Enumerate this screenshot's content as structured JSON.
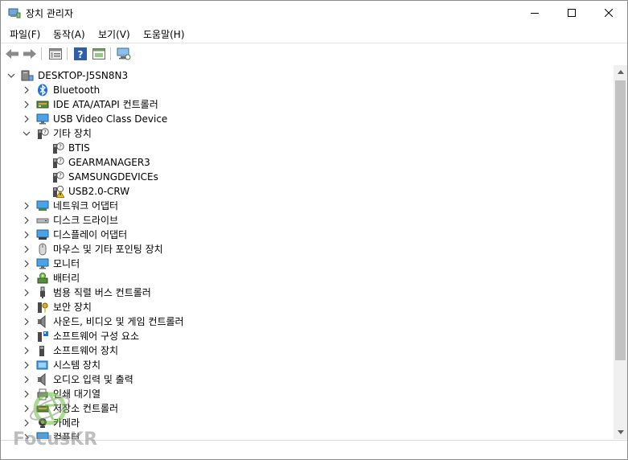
{
  "window": {
    "title": "장치 관리자"
  },
  "menu": {
    "items": [
      "파일(F)",
      "동작(A)",
      "보기(V)",
      "도움말(H)"
    ]
  },
  "toolbar": {
    "buttons": [
      "back-arrow-icon",
      "forward-arrow-icon",
      "properties-icon",
      "help-icon",
      "update-driver-icon",
      "scan-hardware-icon"
    ]
  },
  "tree": {
    "root": "DESKTOP-J5SN8N3",
    "items": [
      {
        "label": "Bluetooth",
        "icon": "bluetooth-icon",
        "expander": "collapsed",
        "level": 1
      },
      {
        "label": "IDE ATA/ATAPI 컨트롤러",
        "icon": "ide-controller-icon",
        "expander": "collapsed",
        "level": 1
      },
      {
        "label": "USB Video Class Device",
        "icon": "monitor-icon",
        "expander": "collapsed",
        "level": 1
      },
      {
        "label": "기타 장치",
        "icon": "unknown-device-icon",
        "expander": "expanded",
        "level": 1
      },
      {
        "label": "BTIS",
        "icon": "unknown-device-icon",
        "expander": "none",
        "level": 2
      },
      {
        "label": "GEARMANAGER3",
        "icon": "unknown-device-icon",
        "expander": "none",
        "level": 2
      },
      {
        "label": "SAMSUNGDEVICEs",
        "icon": "unknown-device-icon",
        "expander": "none",
        "level": 2
      },
      {
        "label": "USB2.0-CRW",
        "icon": "warning-device-icon",
        "expander": "none",
        "level": 2
      },
      {
        "label": "네트워크 어댑터",
        "icon": "network-adapter-icon",
        "expander": "collapsed",
        "level": 1
      },
      {
        "label": "디스크 드라이브",
        "icon": "disk-drive-icon",
        "expander": "collapsed",
        "level": 1
      },
      {
        "label": "디스플레이 어댑터",
        "icon": "display-adapter-icon",
        "expander": "collapsed",
        "level": 1
      },
      {
        "label": "마우스 및 기타 포인팅 장치",
        "icon": "mouse-icon",
        "expander": "collapsed",
        "level": 1
      },
      {
        "label": "모니터",
        "icon": "monitor-icon",
        "expander": "collapsed",
        "level": 1
      },
      {
        "label": "배터리",
        "icon": "battery-icon",
        "expander": "collapsed",
        "level": 1
      },
      {
        "label": "범용 직렬 버스 컨트롤러",
        "icon": "usb-icon",
        "expander": "collapsed",
        "level": 1
      },
      {
        "label": "보안 장치",
        "icon": "security-key-icon",
        "expander": "collapsed",
        "level": 1
      },
      {
        "label": "사운드, 비디오 및 게임 컨트롤러",
        "icon": "speaker-icon",
        "expander": "collapsed",
        "level": 1
      },
      {
        "label": "소프트웨어 구성 요소",
        "icon": "software-component-icon",
        "expander": "collapsed",
        "level": 1
      },
      {
        "label": "소프트웨어 장치",
        "icon": "software-device-icon",
        "expander": "collapsed",
        "level": 1
      },
      {
        "label": "시스템 장치",
        "icon": "system-device-icon",
        "expander": "collapsed",
        "level": 1
      },
      {
        "label": "오디오 입력 및 출력",
        "icon": "speaker-icon",
        "expander": "collapsed",
        "level": 1
      },
      {
        "label": "인쇄 대기열",
        "icon": "printer-icon",
        "expander": "collapsed",
        "level": 1
      },
      {
        "label": "저장소 컨트롤러",
        "icon": "storage-controller-icon",
        "expander": "collapsed",
        "level": 1
      },
      {
        "label": "카메라",
        "icon": "camera-icon",
        "expander": "collapsed",
        "level": 1
      },
      {
        "label": "컴퓨터",
        "icon": "computer-icon",
        "expander": "collapsed",
        "level": 1
      }
    ]
  },
  "watermark": {
    "text": "FocusKR"
  },
  "colors": {
    "accent": "#1e73d6",
    "warning": "#f5c400",
    "thumb": "#c2c2c2"
  }
}
